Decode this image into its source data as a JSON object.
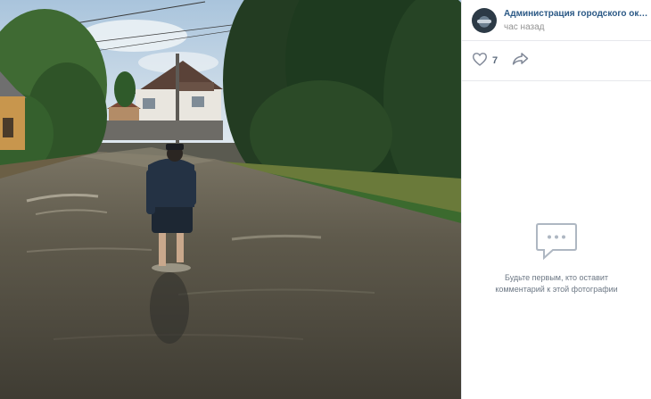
{
  "post": {
    "author": "Администрация городского округа",
    "time": "час назад",
    "likes": "7"
  },
  "comments": {
    "empty_text": "Будьте первым, кто оставит комментарий к этой фотографии"
  },
  "icons": {
    "like": "heart-outline-icon",
    "share": "share-arrow-icon",
    "comments_placeholder": "speech-bubble-icon"
  },
  "colors": {
    "accent_link": "#2a5885",
    "muted_text": "#939393",
    "icon_gray": "#828a99",
    "divider": "#e7e8ec"
  }
}
